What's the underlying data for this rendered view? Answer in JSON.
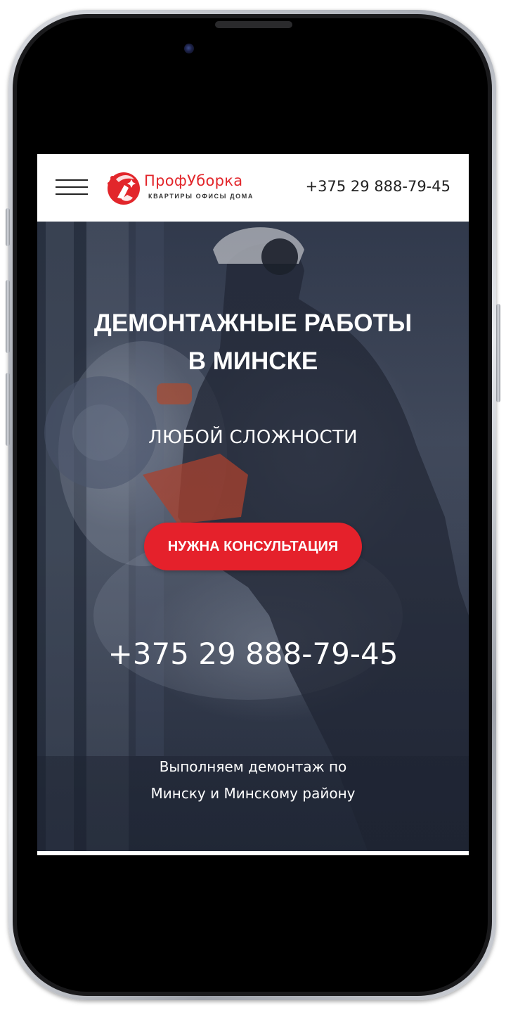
{
  "header": {
    "menu_icon": "hamburger-menu-icon",
    "logo": {
      "icon": "cleaning-logo-icon",
      "name": "ПрофУборка",
      "tagline": "КВАРТИРЫ ОФИСЫ ДОМА"
    },
    "phone": "+375 29 888-79-45"
  },
  "hero": {
    "title": "ДЕМОНТАЖНЫЕ РАБОТЫ В МИНСКЕ",
    "subtitle": "ЛЮБОЙ СЛОЖНОСТИ",
    "cta_label": "НУЖНА КОНСУЛЬТАЦИЯ",
    "phone": "+375 29 888-79-45",
    "description": "Выполняем демонтаж по Минску и Минскому району"
  },
  "colors": {
    "brand_red": "#e5212b",
    "text_dark": "#222222",
    "hero_text": "#ffffff"
  }
}
